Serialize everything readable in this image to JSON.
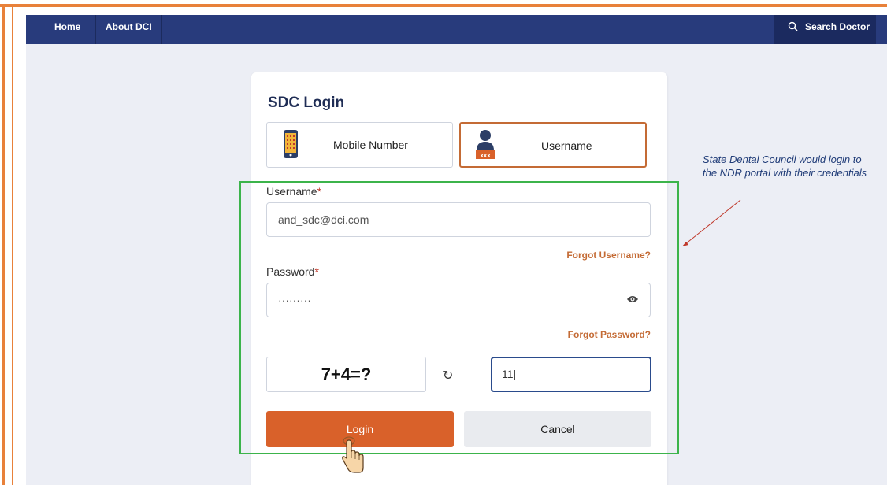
{
  "nav": {
    "home": "Home",
    "about": "About DCI",
    "search": "Search Doctor"
  },
  "login": {
    "title": "SDC Login",
    "tabs": {
      "mobile": "Mobile Number",
      "username": "Username",
      "username_icon_text": "xxx"
    },
    "username_label": "Username",
    "username_value": "and_sdc@dci.com",
    "forgot_username": "Forgot Username?",
    "password_label": "Password",
    "password_value": "·········",
    "forgot_password": "Forgot Password?",
    "required_mark": "*",
    "captcha_question": "7+4=?",
    "captcha_answer": "11|",
    "login_button": "Login",
    "cancel_button": "Cancel"
  },
  "annotation": {
    "text": "State Dental Council would login to the NDR portal with their credentials"
  },
  "colors": {
    "frame": "#e8813a",
    "navbar": "#283b7c",
    "accent": "#d9612a",
    "highlight_box": "#3cb44b"
  }
}
